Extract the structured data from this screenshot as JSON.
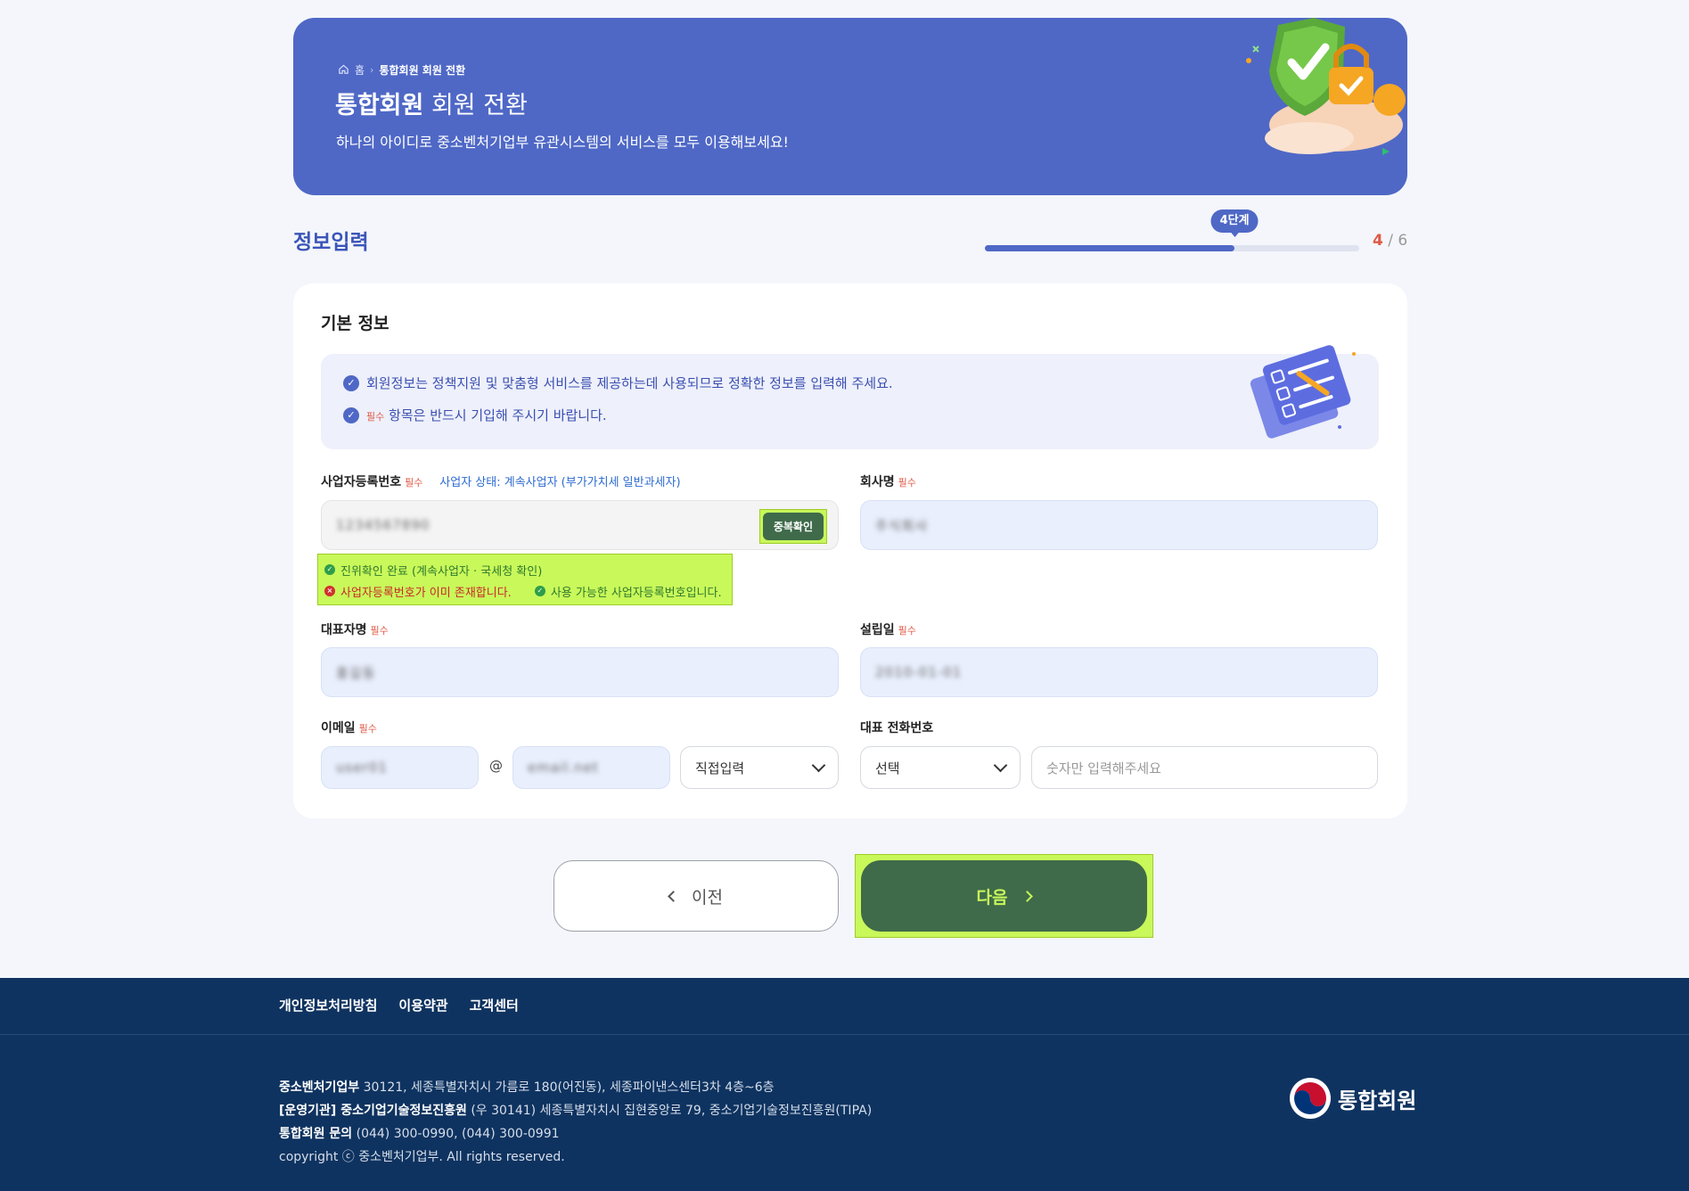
{
  "hero": {
    "breadcrumb_home": "홈",
    "breadcrumb_current": "통합회원 회원 전환",
    "title_bold": "통합회원",
    "title_rest": "회원 전환",
    "description": "하나의 아이디로 중소벤처기업부 유관시스템의 서비스를 모두 이용해보세요!"
  },
  "section": {
    "title": "정보입력",
    "step_bubble": "4단계",
    "step_current": "4",
    "step_sep": "/",
    "step_total": "6",
    "progress_fraction": 0.667
  },
  "card": {
    "title": "기본 정보",
    "notice_1": "회원정보는 정책지원 및 맞춤형 서비스를 제공하는데 사용되므로 정확한 정보를 입력해 주세요.",
    "notice_2_req": "필수",
    "notice_2": "항목은 반드시 기입해 주시기 바랍니다."
  },
  "fields": {
    "required_mark": "필수",
    "biz_no": {
      "label": "사업자등록번호",
      "status": "사업자 상태: 계속사업자 (부가가치세 일반과세자)",
      "value": "1234567890",
      "button": "중복확인"
    },
    "messages": {
      "verified": "진위확인 완료 (계속사업자 · 국세청 확인)",
      "exists": "사업자등록번호가 이미 존재합니다.",
      "available": "사용 가능한 사업자등록번호입니다."
    },
    "company": {
      "label": "회사명",
      "value": "주식회사"
    },
    "ceo": {
      "label": "대표자명",
      "value": "홍길동"
    },
    "founded": {
      "label": "설립일",
      "value": "2010-01-01"
    },
    "email": {
      "label": "이메일",
      "local": "user01",
      "at": "@",
      "domain": "email.net",
      "select": "직접입력"
    },
    "phone": {
      "label": "대표 전화번호",
      "select": "선택",
      "placeholder": "숫자만 입력해주세요"
    }
  },
  "buttons": {
    "prev": "이전",
    "next": "다음"
  },
  "footer": {
    "links": [
      "개인정보처리방침",
      "이용약관",
      "고객센터"
    ],
    "line1_bold": "중소벤처기업부",
    "line1": "30121, 세종특별자치시 가름로 180(어진동), 세종파이낸스센터3차 4층~6층",
    "line2_bold": "[운영기관] 중소기업기술정보진흥원",
    "line2": "(우 30141) 세종특별자치시 집현중앙로 79, 중소기업기술정보진흥원(TIPA)",
    "line3_bold": "통합회원 문의",
    "line3": "(044) 300-0990, (044) 300-0991",
    "copyright": "copyright ⓒ 중소벤처기업부. All rights reserved.",
    "logo_text": "통합회원"
  },
  "colors": {
    "brand_blue": "#4f68c6",
    "highlight": "#c9f85a",
    "button_green": "#3f6b4a",
    "footer_navy": "#0f3360",
    "required_red": "#e05a47"
  }
}
